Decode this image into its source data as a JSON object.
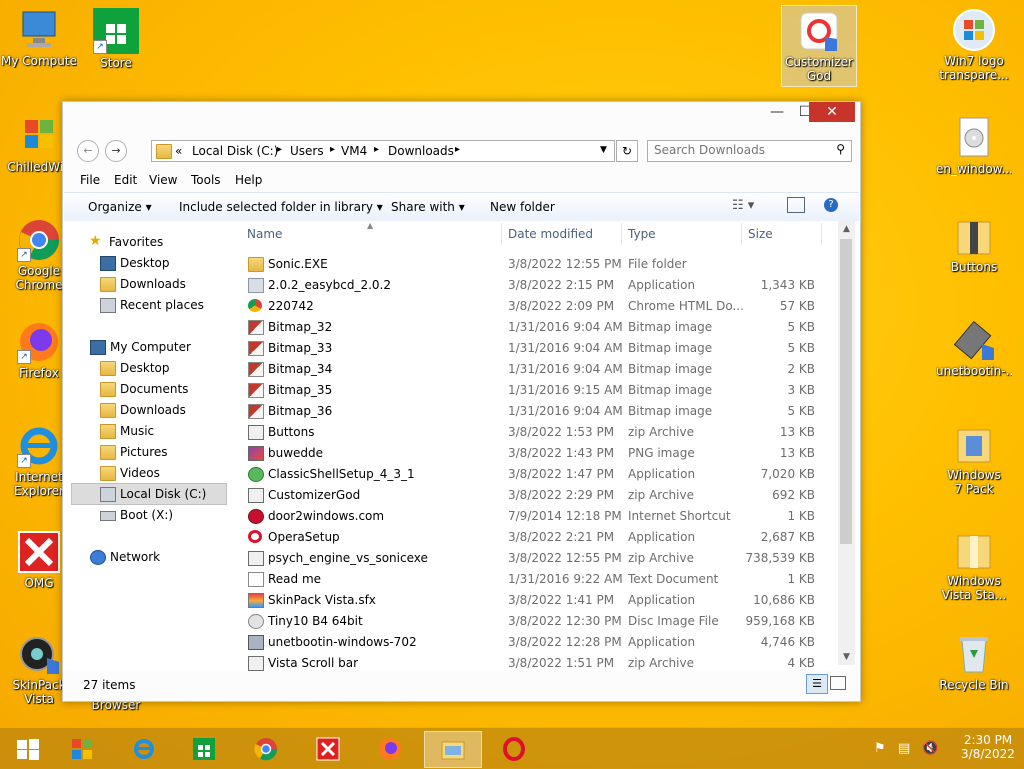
{
  "desktop": {
    "icons": [
      {
        "label": "My Computer"
      },
      {
        "label": "Store"
      },
      {
        "label": "ChilledWin"
      },
      {
        "label": "Google Chrome"
      },
      {
        "label": "Firefox"
      },
      {
        "label": "Internet Explorer"
      },
      {
        "label": "OMG"
      },
      {
        "label": "SkinPack Vista"
      },
      {
        "label": "Browser"
      },
      {
        "label": "CustomizerGod"
      },
      {
        "label": "Win7 logo transpare..."
      },
      {
        "label": "en_window..."
      },
      {
        "label": "Buttons"
      },
      {
        "label": "unetbootin-..."
      },
      {
        "label": "Windows 7 Pack"
      },
      {
        "label": "Windows Vista Sta..."
      },
      {
        "label": "Recycle Bin"
      }
    ]
  },
  "window": {
    "controls": {
      "minimize": "—",
      "maximize": "☐",
      "close": "✕"
    },
    "address": {
      "prefix": "«",
      "crumbs": [
        "Local Disk (C:)",
        "Users",
        "VM4",
        "Downloads"
      ],
      "separator": "▸"
    },
    "search": {
      "placeholder": "Search Downloads"
    },
    "menu": [
      "File",
      "Edit",
      "View",
      "Tools",
      "Help"
    ],
    "commands": {
      "organize": "Organize ▾",
      "include": "Include selected folder in library ▾",
      "share": "Share with ▾",
      "new_folder": "New folder"
    },
    "nav": {
      "favorites": "Favorites",
      "fav_items": [
        "Desktop",
        "Downloads",
        "Recent places"
      ],
      "computer": "My Computer",
      "computer_items": [
        "Desktop",
        "Documents",
        "Downloads",
        "Music",
        "Pictures",
        "Videos",
        "Local Disk (C:)",
        "Boot (X:)"
      ],
      "network": "Network"
    },
    "columns": {
      "name": "Name",
      "date": "Date modified",
      "type": "Type",
      "size": "Size"
    },
    "files": [
      {
        "name": "Sonic.EXE",
        "date": "3/8/2022 12:55 PM",
        "type": "File folder",
        "size": "",
        "icon": "folder"
      },
      {
        "name": "2.0.2_easybcd_2.0.2",
        "date": "3/8/2022 2:15 PM",
        "type": "Application",
        "size": "1,343 KB",
        "icon": "app"
      },
      {
        "name": "220742",
        "date": "3/8/2022 2:09 PM",
        "type": "Chrome HTML Do...",
        "size": "57 KB",
        "icon": "chrome"
      },
      {
        "name": "Bitmap_32",
        "date": "1/31/2016 9:04 AM",
        "type": "Bitmap image",
        "size": "5 KB",
        "icon": "bmp"
      },
      {
        "name": "Bitmap_33",
        "date": "1/31/2016 9:04 AM",
        "type": "Bitmap image",
        "size": "5 KB",
        "icon": "bmp"
      },
      {
        "name": "Bitmap_34",
        "date": "1/31/2016 9:04 AM",
        "type": "Bitmap image",
        "size": "2 KB",
        "icon": "bmp"
      },
      {
        "name": "Bitmap_35",
        "date": "1/31/2016 9:15 AM",
        "type": "Bitmap image",
        "size": "3 KB",
        "icon": "bmp"
      },
      {
        "name": "Bitmap_36",
        "date": "1/31/2016 9:04 AM",
        "type": "Bitmap image",
        "size": "5 KB",
        "icon": "bmp"
      },
      {
        "name": "Buttons",
        "date": "3/8/2022 1:53 PM",
        "type": "zip Archive",
        "size": "13 KB",
        "icon": "zip"
      },
      {
        "name": "buwedde",
        "date": "3/8/2022 1:43 PM",
        "type": "PNG image",
        "size": "13 KB",
        "icon": "png"
      },
      {
        "name": "ClassicShellSetup_4_3_1",
        "date": "3/8/2022 1:47 PM",
        "type": "Application",
        "size": "7,020 KB",
        "icon": "shell"
      },
      {
        "name": "CustomizerGod",
        "date": "3/8/2022 2:29 PM",
        "type": "zip Archive",
        "size": "692 KB",
        "icon": "zip"
      },
      {
        "name": "door2windows.com",
        "date": "7/9/2014 12:18 PM",
        "type": "Internet Shortcut",
        "size": "1 KB",
        "icon": "url"
      },
      {
        "name": "OperaSetup",
        "date": "3/8/2022 2:21 PM",
        "type": "Application",
        "size": "2,687 KB",
        "icon": "opera"
      },
      {
        "name": "psych_engine_vs_sonicexe",
        "date": "3/8/2022 12:55 PM",
        "type": "zip Archive",
        "size": "738,539 KB",
        "icon": "zip"
      },
      {
        "name": "Read me",
        "date": "1/31/2016 9:22 AM",
        "type": "Text Document",
        "size": "1 KB",
        "icon": "txt"
      },
      {
        "name": "SkinPack Vista.sfx",
        "date": "3/8/2022 1:41 PM",
        "type": "Application",
        "size": "10,686 KB",
        "icon": "skin"
      },
      {
        "name": "Tiny10 B4 64bit",
        "date": "3/8/2022 12:30 PM",
        "type": "Disc Image File",
        "size": "959,168 KB",
        "icon": "disc"
      },
      {
        "name": "unetbootin-windows-702",
        "date": "3/8/2022 12:28 PM",
        "type": "Application",
        "size": "4,746 KB",
        "icon": "unet"
      },
      {
        "name": "Vista Scroll bar",
        "date": "3/8/2022 1:51 PM",
        "type": "zip Archive",
        "size": "4 KB",
        "icon": "zip"
      }
    ],
    "status": "27 items"
  },
  "taskbar": {
    "clock_time": "2:30 PM",
    "clock_date": "3/8/2022"
  }
}
